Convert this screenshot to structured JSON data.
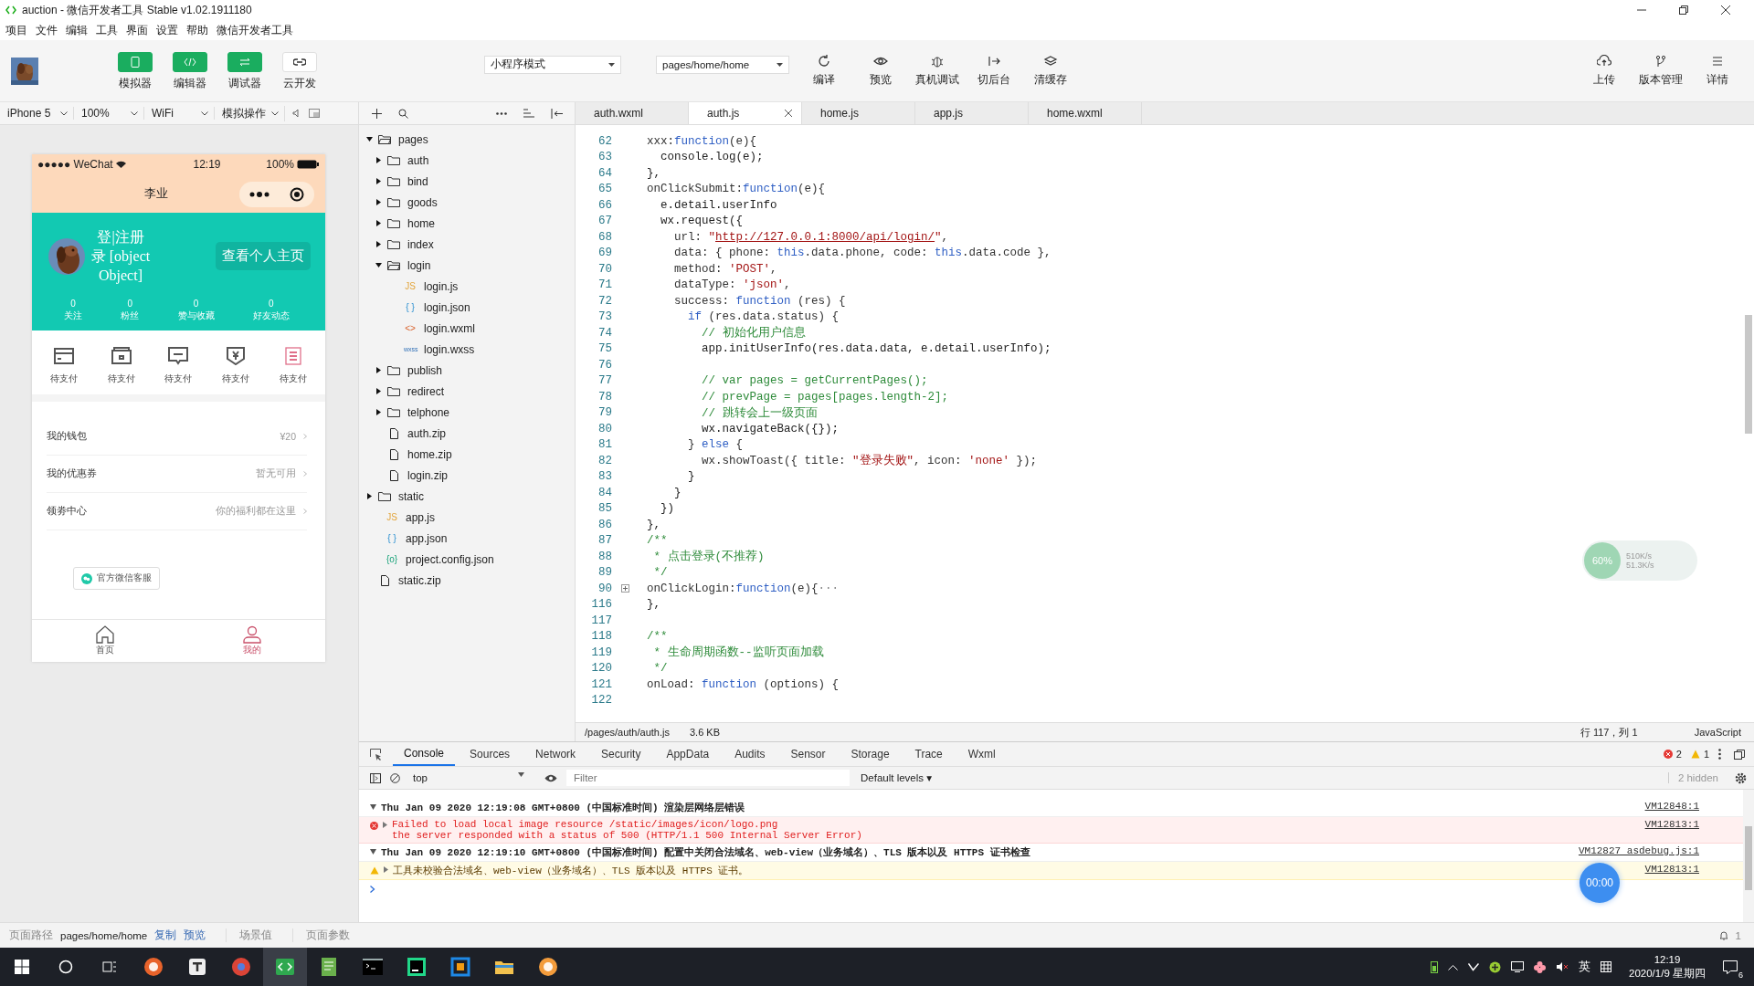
{
  "window": {
    "title": "auction - 微信开发者工具 Stable v1.02.1911180"
  },
  "menu": [
    "项目",
    "文件",
    "编辑",
    "工具",
    "界面",
    "设置",
    "帮助",
    "微信开发者工具"
  ],
  "toolbar": {
    "panels": [
      {
        "label": "模拟器",
        "kind": "phone",
        "on": true
      },
      {
        "label": "编辑器",
        "kind": "code",
        "on": true
      },
      {
        "label": "调试器",
        "kind": "debug",
        "on": true
      },
      {
        "label": "云开发",
        "kind": "cloud",
        "on": false
      }
    ],
    "mode": "小程序模式",
    "page": "pages/home/home",
    "actions": [
      {
        "label": "编译",
        "kind": "refresh"
      },
      {
        "label": "预览",
        "kind": "eye"
      },
      {
        "label": "真机调试",
        "kind": "bug"
      },
      {
        "label": "切后台",
        "kind": "switch"
      },
      {
        "label": "清缓存",
        "kind": "layers"
      }
    ],
    "right": [
      {
        "label": "上传",
        "kind": "upload"
      },
      {
        "label": "版本管理",
        "kind": "branch"
      },
      {
        "label": "详情",
        "kind": "menu"
      }
    ]
  },
  "simulator_bar": [
    "iPhone 5",
    "100%",
    "WiFi",
    "模拟操作"
  ],
  "editor_tabs": [
    {
      "label": "auth.wxml",
      "selected": false
    },
    {
      "label": "auth.js",
      "selected": true
    },
    {
      "label": "home.js",
      "selected": false
    },
    {
      "label": "app.js",
      "selected": false
    },
    {
      "label": "home.wxml",
      "selected": false
    }
  ],
  "phone": {
    "status": {
      "carrier": "●●●●● WeChat",
      "time": "12:19",
      "battery": "100%"
    },
    "title": "李业",
    "profile": {
      "name_lines": [
        "登|注册",
        "录 [object",
        "Object]"
      ],
      "button": "查看个人主页",
      "stats": [
        {
          "value": "0",
          "label": "关注"
        },
        {
          "value": "0",
          "label": "粉丝"
        },
        {
          "value": "0",
          "label": "赞与收藏"
        },
        {
          "value": "0",
          "label": "好友动态"
        }
      ]
    },
    "orders": [
      {
        "label": "待支付",
        "kind": "card",
        "color": "#555555"
      },
      {
        "label": "待支付",
        "kind": "box",
        "color": "#555555"
      },
      {
        "label": "待支付",
        "kind": "chat",
        "color": "#555555"
      },
      {
        "label": "待支付",
        "kind": "yen",
        "color": "#555555"
      },
      {
        "label": "待支付",
        "kind": "list",
        "color": "#e0708a"
      }
    ],
    "menu": [
      {
        "label": "我的钱包",
        "value": "¥20"
      },
      {
        "label": "我的优惠券",
        "value": "暂无可用"
      },
      {
        "label": "领劵中心",
        "value": "你的福利都在这里"
      }
    ],
    "service_button": "官方微信客服",
    "tabs": [
      {
        "label": "首页",
        "kind": "home",
        "selected": false
      },
      {
        "label": "我的",
        "kind": "user",
        "selected": true
      }
    ]
  },
  "file_tree": [
    {
      "name": "pages",
      "kind": "folder",
      "expanded": true,
      "children": [
        {
          "name": "auth",
          "kind": "folder",
          "expanded": false
        },
        {
          "name": "bind",
          "kind": "folder",
          "expanded": false
        },
        {
          "name": "goods",
          "kind": "folder",
          "expanded": false
        },
        {
          "name": "home",
          "kind": "folder",
          "expanded": false
        },
        {
          "name": "index",
          "kind": "folder",
          "expanded": false
        },
        {
          "name": "login",
          "kind": "folder",
          "expanded": true,
          "children": [
            {
              "name": "login.js",
              "kind": "js",
              "icon": "JS"
            },
            {
              "name": "login.json",
              "kind": "json",
              "icon": "{ }"
            },
            {
              "name": "login.wxml",
              "kind": "wxml",
              "icon": "<>"
            },
            {
              "name": "login.wxss",
              "kind": "wxss",
              "icon": "wxss"
            }
          ]
        },
        {
          "name": "publish",
          "kind": "folder",
          "expanded": false
        },
        {
          "name": "redirect",
          "kind": "folder",
          "expanded": false
        },
        {
          "name": "telphone",
          "kind": "folder",
          "expanded": false
        },
        {
          "name": "auth.zip",
          "kind": "file"
        },
        {
          "name": "home.zip",
          "kind": "file"
        },
        {
          "name": "login.zip",
          "kind": "file"
        }
      ]
    },
    {
      "name": "static",
      "kind": "folder",
      "expanded": false
    },
    {
      "name": "app.js",
      "kind": "js",
      "icon": "JS"
    },
    {
      "name": "app.json",
      "kind": "json",
      "icon": "{ }"
    },
    {
      "name": "project.config.json",
      "kind": "config",
      "icon": "{o}"
    },
    {
      "name": "static.zip",
      "kind": "file"
    }
  ],
  "code": [
    {
      "number": "62",
      "tokens": [
        {
          "kind": "plain",
          "text": "xxx:"
        },
        {
          "kind": "keyword",
          "text": "function"
        },
        {
          "kind": "plain",
          "text": "(e){"
        }
      ]
    },
    {
      "number": "63",
      "text": "  console.log(e);"
    },
    {
      "number": "64",
      "text": "},"
    },
    {
      "number": "65",
      "tokens": [
        {
          "kind": "plain",
          "text": "onClickSubmit:"
        },
        {
          "kind": "keyword",
          "text": "function"
        },
        {
          "kind": "plain",
          "text": "(e){"
        }
      ]
    },
    {
      "number": "66",
      "text": "  e.detail.userInfo"
    },
    {
      "number": "67",
      "text": "  wx.request({"
    },
    {
      "number": "68",
      "tokens": [
        {
          "kind": "plain",
          "text": "    url: "
        },
        {
          "kind": "string",
          "text": "\""
        },
        {
          "kind": "link",
          "text": "http://127.0.0.1:8000/api/login/"
        },
        {
          "kind": "string",
          "text": "\""
        },
        {
          "kind": "plain",
          "text": ","
        }
      ]
    },
    {
      "number": "69",
      "tokens": [
        {
          "kind": "plain",
          "text": "    data: { phone: "
        },
        {
          "kind": "keyword",
          "text": "this"
        },
        {
          "kind": "plain",
          "text": ".data.phone, code: "
        },
        {
          "kind": "keyword",
          "text": "this"
        },
        {
          "kind": "plain",
          "text": ".data.code },"
        }
      ]
    },
    {
      "number": "70",
      "tokens": [
        {
          "kind": "plain",
          "text": "    method: "
        },
        {
          "kind": "string",
          "text": "'POST'"
        },
        {
          "kind": "plain",
          "text": ","
        }
      ]
    },
    {
      "number": "71",
      "tokens": [
        {
          "kind": "plain",
          "text": "    dataType: "
        },
        {
          "kind": "string",
          "text": "'json'"
        },
        {
          "kind": "plain",
          "text": ","
        }
      ]
    },
    {
      "number": "72",
      "tokens": [
        {
          "kind": "plain",
          "text": "    success: "
        },
        {
          "kind": "keyword",
          "text": "function"
        },
        {
          "kind": "plain",
          "text": " (res) {"
        }
      ]
    },
    {
      "number": "73",
      "tokens": [
        {
          "kind": "keyword",
          "text": "      if"
        },
        {
          "kind": "plain",
          "text": " (res.data.status) {"
        }
      ]
    },
    {
      "number": "74",
      "tokens": [
        {
          "kind": "comment",
          "text": "        // 初始化用户信息"
        }
      ]
    },
    {
      "number": "75",
      "text": "        app.initUserInfo(res.data.data, e.detail.userInfo);"
    },
    {
      "number": "76"
    },
    {
      "number": "77",
      "tokens": [
        {
          "kind": "comment",
          "text": "        // var pages = getCurrentPages();"
        }
      ]
    },
    {
      "number": "78",
      "tokens": [
        {
          "kind": "comment",
          "text": "        // prevPage = pages[pages.length-2];"
        }
      ]
    },
    {
      "number": "79",
      "tokens": [
        {
          "kind": "comment",
          "text": "        // 跳转会上一级页面"
        }
      ]
    },
    {
      "number": "80",
      "text": "        wx.navigateBack({});"
    },
    {
      "number": "81",
      "tokens": [
        {
          "kind": "plain",
          "text": "      } "
        },
        {
          "kind": "keyword",
          "text": "else"
        },
        {
          "kind": "plain",
          "text": " {"
        }
      ]
    },
    {
      "number": "82",
      "tokens": [
        {
          "kind": "plain",
          "text": "        wx.showToast({ title: "
        },
        {
          "kind": "string",
          "text": "\"登录失败\""
        },
        {
          "kind": "plain",
          "text": ", icon: "
        },
        {
          "kind": "string",
          "text": "'none'"
        },
        {
          "kind": "plain",
          "text": " });"
        }
      ]
    },
    {
      "number": "83",
      "text": "      }"
    },
    {
      "number": "84",
      "text": "    }"
    },
    {
      "number": "85",
      "text": "  })"
    },
    {
      "number": "86",
      "text": "},"
    },
    {
      "number": "87",
      "tokens": [
        {
          "kind": "comment",
          "text": "/**"
        }
      ]
    },
    {
      "number": "88",
      "tokens": [
        {
          "kind": "comment",
          "text": " * 点击登录(不推荐)"
        }
      ]
    },
    {
      "number": "89",
      "tokens": [
        {
          "kind": "comment",
          "text": " */"
        }
      ]
    },
    {
      "number": "90",
      "folded": true,
      "tokens": [
        {
          "kind": "plain",
          "text": "onClickLogin:"
        },
        {
          "kind": "keyword",
          "text": "function"
        },
        {
          "kind": "plain",
          "text": "(e){"
        },
        {
          "kind": "fold",
          "text": "···"
        }
      ]
    },
    {
      "number": "116",
      "text": "},"
    },
    {
      "number": "117"
    },
    {
      "number": "118",
      "tokens": [
        {
          "kind": "comment",
          "text": "/**"
        }
      ]
    },
    {
      "number": "119",
      "tokens": [
        {
          "kind": "comment",
          "text": " * 生命周期函数--监听页面加载"
        }
      ]
    },
    {
      "number": "120",
      "tokens": [
        {
          "kind": "comment",
          "text": " */"
        }
      ]
    },
    {
      "number": "121",
      "tokens": [
        {
          "kind": "plain",
          "text": "onLoad: "
        },
        {
          "kind": "keyword",
          "text": "function"
        },
        {
          "kind": "plain",
          "text": " (options) {"
        }
      ]
    },
    {
      "number": "122"
    }
  ],
  "editor_status": {
    "path": "/pages/auth/auth.js",
    "size": "3.6 KB",
    "position": "行 117，列 1",
    "language": "JavaScript"
  },
  "devtools": {
    "tabs": [
      {
        "label": "Console",
        "selected": true
      },
      {
        "label": "Sources",
        "selected": false
      },
      {
        "label": "Network",
        "selected": false
      },
      {
        "label": "Security",
        "selected": false
      },
      {
        "label": "AppData",
        "selected": false
      },
      {
        "label": "Audits",
        "selected": false
      },
      {
        "label": "Sensor",
        "selected": false
      },
      {
        "label": "Storage",
        "selected": false
      },
      {
        "label": "Trace",
        "selected": false
      },
      {
        "label": "Wxml",
        "selected": false
      }
    ],
    "errors": "2",
    "warnings": "1",
    "context": "top",
    "filter_placeholder": "Filter",
    "levels": "Default levels ▾",
    "hidden": "2 hidden",
    "messages": [
      {
        "kind": "group",
        "text": "Thu Jan 09 2020 12:19:08 GMT+0800 (中国标准时间) 渲染层网络层错误",
        "source": "VM12848:1"
      },
      {
        "kind": "error",
        "lines": [
          "Failed to load local image resource /static/images/icon/logo.png",
          "the server responded with a status of 500 (HTTP/1.1 500 Internal Server Error)"
        ],
        "source": "VM12813:1"
      },
      {
        "kind": "group",
        "text": "Thu Jan 09 2020 12:19:10 GMT+0800 (中国标准时间) 配置中关闭合法域名、web-view（业务域名）、TLS 版本以及 HTTPS 证书检查",
        "source": "VM12827 asdebug.js:1"
      },
      {
        "kind": "warning",
        "lines": [
          "工具未校验合法域名、web-view（业务域名）、TLS 版本以及 HTTPS 证书。"
        ],
        "source": "VM12813:1"
      }
    ]
  },
  "net_monitor": {
    "percent": "60%",
    "up": "510K/s",
    "down": "51.3K/s"
  },
  "timer": "00:00",
  "status_bar": {
    "label": "页面路径",
    "path": "pages/home/home",
    "links": [
      "复制",
      "预览"
    ],
    "items": [
      "场景值",
      "页面参数"
    ],
    "notifications": "1"
  },
  "taskbar": {
    "apps": [
      {
        "kind": "fox",
        "color": "#e8632b",
        "selected": false
      },
      {
        "kind": "letter",
        "color": "#eeeeee",
        "selected": false
      },
      {
        "kind": "ring",
        "color": "#db4437",
        "selected": false
      },
      {
        "kind": "code",
        "color": "#2fa84f",
        "selected": true
      },
      {
        "kind": "pad",
        "color": "#6ab04c",
        "selected": false
      },
      {
        "kind": "terminal",
        "color": "#000000",
        "selected": false
      },
      {
        "kind": "ide",
        "color": "#21d789",
        "selected": false
      },
      {
        "kind": "window",
        "color": "#1e88e5",
        "selected": false
      },
      {
        "kind": "folder",
        "color": "#f2c14e",
        "selected": false
      },
      {
        "kind": "circle",
        "color": "#f39c3c",
        "selected": false
      }
    ],
    "ime": "英",
    "time": "12:19",
    "date": "2020/1/9 星期四",
    "notices": "6"
  }
}
